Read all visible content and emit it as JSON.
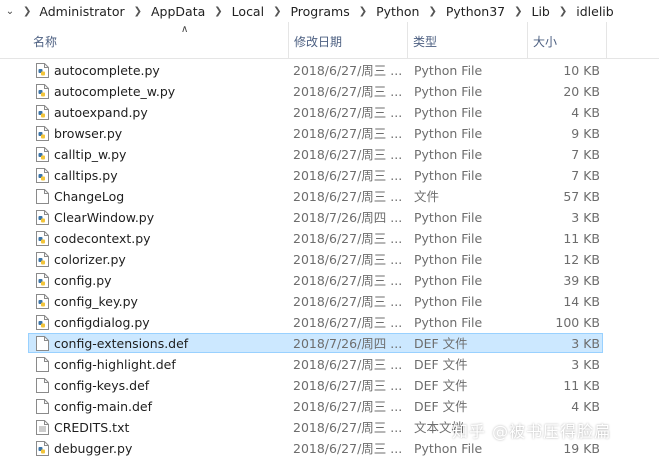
{
  "breadcrumb": [
    "Administrator",
    "AppData",
    "Local",
    "Programs",
    "Python",
    "Python37",
    "Lib",
    "idlelib"
  ],
  "columns": {
    "name": "名称",
    "modified": "修改日期",
    "type": "类型",
    "size": "大小"
  },
  "files": [
    {
      "name": "autocomplete.py",
      "modified": "2018/6/27/周三 ...",
      "type": "Python File",
      "size": "10 KB",
      "icon": "python-file-icon"
    },
    {
      "name": "autocomplete_w.py",
      "modified": "2018/6/27/周三 ...",
      "type": "Python File",
      "size": "20 KB",
      "icon": "python-file-icon"
    },
    {
      "name": "autoexpand.py",
      "modified": "2018/6/27/周三 ...",
      "type": "Python File",
      "size": "4 KB",
      "icon": "python-file-icon"
    },
    {
      "name": "browser.py",
      "modified": "2018/6/27/周三 ...",
      "type": "Python File",
      "size": "9 KB",
      "icon": "python-file-icon"
    },
    {
      "name": "calltip_w.py",
      "modified": "2018/6/27/周三 ...",
      "type": "Python File",
      "size": "7 KB",
      "icon": "python-file-icon"
    },
    {
      "name": "calltips.py",
      "modified": "2018/6/27/周三 ...",
      "type": "Python File",
      "size": "7 KB",
      "icon": "python-file-icon"
    },
    {
      "name": "ChangeLog",
      "modified": "2018/6/27/周三 ...",
      "type": "文件",
      "size": "57 KB",
      "icon": "blank-file-icon"
    },
    {
      "name": "ClearWindow.py",
      "modified": "2018/7/26/周四 ...",
      "type": "Python File",
      "size": "3 KB",
      "icon": "python-file-icon"
    },
    {
      "name": "codecontext.py",
      "modified": "2018/6/27/周三 ...",
      "type": "Python File",
      "size": "11 KB",
      "icon": "python-file-icon"
    },
    {
      "name": "colorizer.py",
      "modified": "2018/6/27/周三 ...",
      "type": "Python File",
      "size": "12 KB",
      "icon": "python-file-icon"
    },
    {
      "name": "config.py",
      "modified": "2018/6/27/周三 ...",
      "type": "Python File",
      "size": "39 KB",
      "icon": "python-file-icon"
    },
    {
      "name": "config_key.py",
      "modified": "2018/6/27/周三 ...",
      "type": "Python File",
      "size": "14 KB",
      "icon": "python-file-icon"
    },
    {
      "name": "configdialog.py",
      "modified": "2018/6/27/周三 ...",
      "type": "Python File",
      "size": "100 KB",
      "icon": "python-file-icon"
    },
    {
      "name": "config-extensions.def",
      "modified": "2018/7/26/周四 ...",
      "type": "DEF 文件",
      "size": "3 KB",
      "icon": "blank-file-icon",
      "selected": true
    },
    {
      "name": "config-highlight.def",
      "modified": "2018/6/27/周三 ...",
      "type": "DEF 文件",
      "size": "3 KB",
      "icon": "blank-file-icon"
    },
    {
      "name": "config-keys.def",
      "modified": "2018/6/27/周三 ...",
      "type": "DEF 文件",
      "size": "11 KB",
      "icon": "blank-file-icon"
    },
    {
      "name": "config-main.def",
      "modified": "2018/6/27/周三 ...",
      "type": "DEF 文件",
      "size": "4 KB",
      "icon": "blank-file-icon"
    },
    {
      "name": "CREDITS.txt",
      "modified": "2018/6/27/周三 ...",
      "type": "文本文档",
      "size": "",
      "icon": "text-file-icon"
    },
    {
      "name": "debugger.py",
      "modified": "2018/6/27/周三 ...",
      "type": "Python File",
      "size": "19 KB",
      "icon": "python-file-icon"
    }
  ],
  "watermark": "知乎 @被书压得脸扁",
  "colors": {
    "selection_bg": "#cce8ff",
    "selection_border": "#99d1ff",
    "header_text": "#4d6082"
  }
}
